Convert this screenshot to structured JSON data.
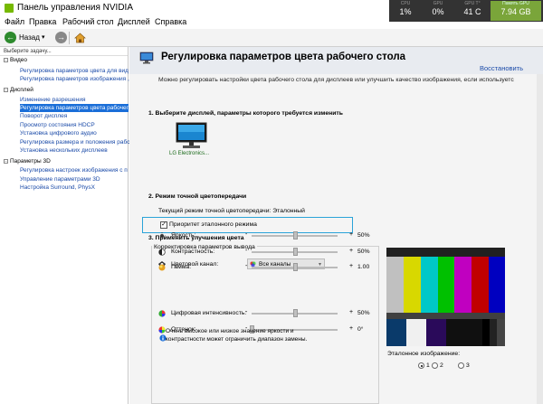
{
  "window": {
    "title": "Панель управления NVIDIA"
  },
  "menu": [
    "Файл",
    "Правка",
    "Рабочий стол",
    "Дисплей",
    "Справка"
  ],
  "stats": [
    {
      "label": "CPU",
      "value": "1%"
    },
    {
      "label": "GPU",
      "value": "0%"
    },
    {
      "label": "GPU T°",
      "value": "41 C"
    },
    {
      "label": "Память GPU",
      "value": "7.94 GB"
    }
  ],
  "toolbar": {
    "back_label": "Назад"
  },
  "sidebar": {
    "heading": "Выберите задачу...",
    "rows": [
      {
        "text": "Видео",
        "kind": "cat"
      },
      {
        "text": "Регулировка параметров цвета для вид",
        "kind": "item"
      },
      {
        "text": "Регулировка параметров изображения ,",
        "kind": "item"
      },
      {
        "text": "Дисплей",
        "kind": "cat"
      },
      {
        "text": "Изменение разрешения",
        "kind": "item"
      },
      {
        "text": "Регулировка параметров цвета рабочег",
        "kind": "item",
        "selected": true
      },
      {
        "text": "Поворот дисплея",
        "kind": "item"
      },
      {
        "text": "Просмотр состояния HDCP",
        "kind": "item"
      },
      {
        "text": "Установка цифрового аудио",
        "kind": "item"
      },
      {
        "text": "Регулировка размера и положения рабс",
        "kind": "item"
      },
      {
        "text": "Установка нескольких дисплеев",
        "kind": "item"
      },
      {
        "text": "Параметры 3D",
        "kind": "cat"
      },
      {
        "text": "Регулировка настроек изображения с п",
        "kind": "item"
      },
      {
        "text": "Управление параметрами 3D",
        "kind": "item"
      },
      {
        "text": "Настройка Surround, PhysX",
        "kind": "item"
      }
    ]
  },
  "main": {
    "title": "Регулировка параметров цвета рабочего стола",
    "restore": "Восстановить",
    "description": "Можно регулировать настройки цвета рабочего стола для дисплеев или улучшить качество изображения, если используетс",
    "section1": "1. Выберите дисплей, параметры которого требуется изменить",
    "display_name": "LG Electronics...",
    "section2": "2. Режим точной цветопередачи",
    "current_mode": "Текущий режим точной цветопередачи: Эталонный",
    "priority_label": "Приоритет эталонного режима",
    "priority_checked": true,
    "section3": "3. Применить улучшения цвета",
    "group_title": "Корректировка параметров вывода",
    "channel_label": "Цветовой канал:",
    "channel_value": "Все каналы",
    "sliders": [
      {
        "label": "Яркость:",
        "value": "50%",
        "level": 0.5
      },
      {
        "label": "Контрастность:",
        "value": "50%",
        "level": 0.5
      },
      {
        "label": "Гамма:",
        "value": "1.00",
        "level": 0.5
      }
    ],
    "warning": "Очень высокое или низкое значение яркости и контрастности может ограничить диапазон замены.",
    "sliders2": [
      {
        "label": "Цифровая интенсивность:",
        "value": "50%",
        "level": 0.5
      },
      {
        "label": "Оттенок:",
        "value": "0°",
        "level": 0.0
      }
    ],
    "reference_label": "Эталонное изображение:",
    "reference_options": [
      "1",
      "2",
      "3"
    ],
    "reference_selected": "1"
  }
}
